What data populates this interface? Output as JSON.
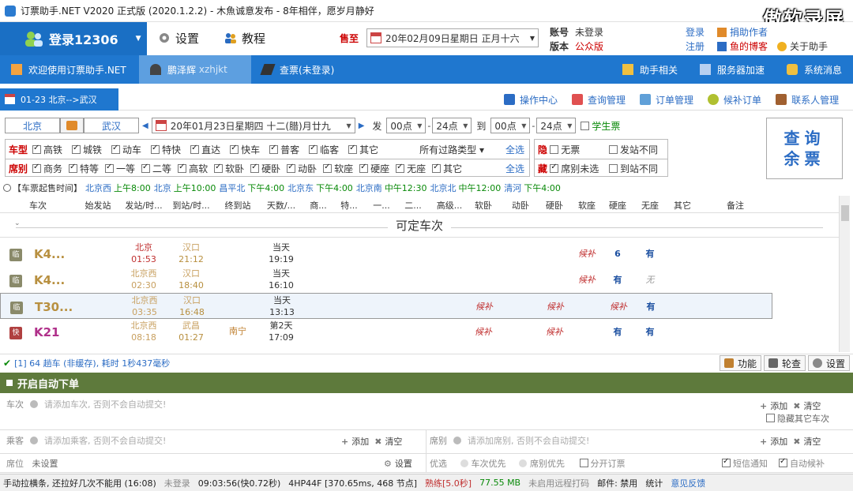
{
  "title": "订票助手.NET V2020 正式版 (2020.1.2.2) - 木魚诚意发布 - 8年相伴，愿岁月静好",
  "watermark": "傲软录屏",
  "header": {
    "login": "登录12306",
    "settings": "设置",
    "tutorial": "教程",
    "shouzhi_label": "售至",
    "date_value": "20年02月09日星期日  正月十六",
    "account_label": "账号",
    "account_value": "未登录",
    "version_label": "版本",
    "version_value": "公众版",
    "login_link": "登录",
    "register_link": "注册",
    "right_items": [
      "捐助作者",
      "鱼的博客",
      "关于助手"
    ]
  },
  "nav": {
    "welcome": "欢迎使用订票助手.NET",
    "user": "鹏泽辉",
    "user_sub": "xzhjkt",
    "query": "查票(未登录)",
    "right": [
      "助手相关",
      "服务器加速",
      "系统消息"
    ]
  },
  "route": {
    "tab": "01-23  北京-->武汉",
    "tools": [
      "操作中心",
      "查询管理",
      "订单管理",
      "候补订单",
      "联系人管理"
    ]
  },
  "query": {
    "from": "北京",
    "to": "武汉",
    "date": "20年01月23日星期四  十二(腊)月廿九",
    "fa": "发",
    "dao": "到",
    "t1": "00点",
    "t2": "24点",
    "t3": "00点",
    "t4": "24点",
    "student": "学生票",
    "search": [
      "查询",
      "余票"
    ]
  },
  "filters": {
    "type_label": "车型",
    "types": [
      "高铁",
      "城铁",
      "动车",
      "特快",
      "直达",
      "快车",
      "普客",
      "临客",
      "其它"
    ],
    "pass_type": "所有过路类型",
    "seat_label": "席别",
    "seats": [
      "商务",
      "特等",
      "一等",
      "二等",
      "高软",
      "软卧",
      "硬卧",
      "动卧",
      "软座",
      "硬座",
      "无座",
      "其它"
    ],
    "select_all": "全选",
    "hide_label": "隐",
    "hide_items": [
      "无票",
      "发站不同"
    ],
    "cang_label": "藏",
    "cang_items": [
      "席别未选",
      "到站不同"
    ]
  },
  "time_row": {
    "label": "【车票起售时间】",
    "items": [
      {
        "st": "北京西",
        "t": "上午8:00"
      },
      {
        "st": "北京",
        "t": "上午10:00"
      },
      {
        "st": "昌平北",
        "t": "下午4:00"
      },
      {
        "st": "北京东",
        "t": "下午4:00"
      },
      {
        "st": "北京南",
        "t": "中午12:30"
      },
      {
        "st": "北京北",
        "t": "中午12:00"
      },
      {
        "st": "清河",
        "t": "下午4:00"
      }
    ]
  },
  "grid": {
    "headers": [
      "车次",
      "始发站",
      "发站/时...",
      "到站/时...",
      "终到站",
      "天数/...",
      "商...",
      "特...",
      "一...",
      "二...",
      "高级...",
      "软卧",
      "动卧",
      "硬卧",
      "软座",
      "硬座",
      "无座",
      "其它",
      "备注"
    ],
    "group": "可定车次",
    "rows": [
      {
        "badge": "临",
        "code": "K4...",
        "from": "北京",
        "dep": "01:53",
        "to": "汉口",
        "arr": "21:12",
        "end": "",
        "day": "当天",
        "dur": "19:19",
        "ruanwo": "",
        "dongwo": "",
        "yingwo": "",
        "ruanzuo": "候补",
        "yingzuo": "6",
        "wuzuo": "有"
      },
      {
        "badge": "临",
        "code": "K4...",
        "from": "北京西",
        "dep": "02:30",
        "to": "汉口",
        "arr": "18:40",
        "end": "",
        "day": "当天",
        "dur": "16:10",
        "ruanwo": "",
        "dongwo": "",
        "yingwo": "",
        "ruanzuo": "候补",
        "yingzuo": "有",
        "wuzuo": "无"
      },
      {
        "badge": "临",
        "code": "T30...",
        "from": "北京西",
        "dep": "03:35",
        "to": "汉口",
        "arr": "16:48",
        "end": "",
        "day": "当天",
        "dur": "13:13",
        "ruanwo": "候补",
        "dongwo": "",
        "yingwo": "候补",
        "ruanzuo": "",
        "yingzuo": "候补",
        "wuzuo": "有"
      },
      {
        "badge": "快",
        "code": "K21",
        "from": "北京西",
        "dep": "08:18",
        "to": "武昌",
        "arr": "01:27",
        "end": "南宁",
        "day": "第2天",
        "dur": "17:09",
        "ruanwo": "候补",
        "dongwo": "",
        "yingwo": "候补",
        "ruanzuo": "",
        "yingzuo": "有",
        "wuzuo": "有"
      }
    ]
  },
  "status": {
    "text": "[1] 64 趟车 (非缓存), 耗时 1秒437毫秒",
    "buttons": [
      "功能",
      "轮查",
      "设置"
    ]
  },
  "auto": {
    "title": "开启自动下单",
    "train_label": "车次",
    "train_ph": "请添加车次, 否则不会自动提交!",
    "add": "添加",
    "clear": "清空",
    "hide_other": "隐藏其它车次",
    "passenger_label": "乘客",
    "passenger_ph": "请添加乘客, 否则不会自动提交!",
    "seat_label": "席别",
    "seat_ph": "请添加席别, 否则不会自动提交!",
    "seatpos_label": "席位",
    "seatpos_value": "未设置",
    "settings": "设置",
    "pref_label": "优选",
    "pref_items": [
      "车次优先",
      "席别优先",
      "分开订票"
    ],
    "sms": "短信通知",
    "auto_hb": "自动候补"
  },
  "bottom": {
    "items": [
      "手动拉横条, 还拉好几次不能用 (16:08)",
      "未登录",
      "09:03:56(快0.72秒)",
      "4HP44F [370.65ms, 468 节点]",
      "熟练[5.0秒]",
      "77.55 MB",
      "未启用远程打码",
      "邮件: 禁用",
      "统计",
      "意见反馈"
    ]
  }
}
